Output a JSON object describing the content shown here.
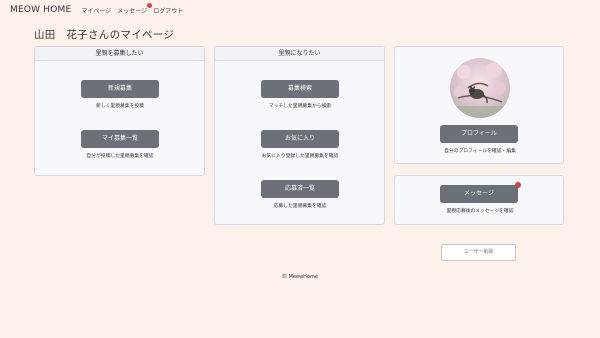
{
  "nav": {
    "brand": "MEOW HOME",
    "links": [
      "マイページ",
      "メッセージ",
      "ログアウト"
    ]
  },
  "page": {
    "title": "山田　花子さんのマイページ"
  },
  "recruit_card": {
    "header": "里親を募集したい",
    "new_button": "新規募集",
    "new_desc": "新しく里親募集を投稿",
    "list_button": "マイ募集一覧",
    "list_desc": "自分が投稿した里親募集を確認"
  },
  "adopt_card": {
    "header": "里親になりたい",
    "search_button": "募集検索",
    "search_desc": "マッチした里親募集から検索",
    "fav_button": "お気に入り",
    "fav_desc": "お気に入り登録した里親募集を確認",
    "applied_button": "応募済一覧",
    "applied_desc": "応募した里親募集を確認"
  },
  "profile_card": {
    "button": "プロフィール",
    "desc": "自分のプロフィールを確認・編集"
  },
  "message_card": {
    "button": "メッセージ",
    "desc": "里親応募後のメッセージを確認"
  },
  "delete_button": "ユーザー削除",
  "footer": "© MeowHome",
  "colors": {
    "background": "#fdf1ec",
    "button": "#6c7079",
    "notification": "#d9414a"
  }
}
